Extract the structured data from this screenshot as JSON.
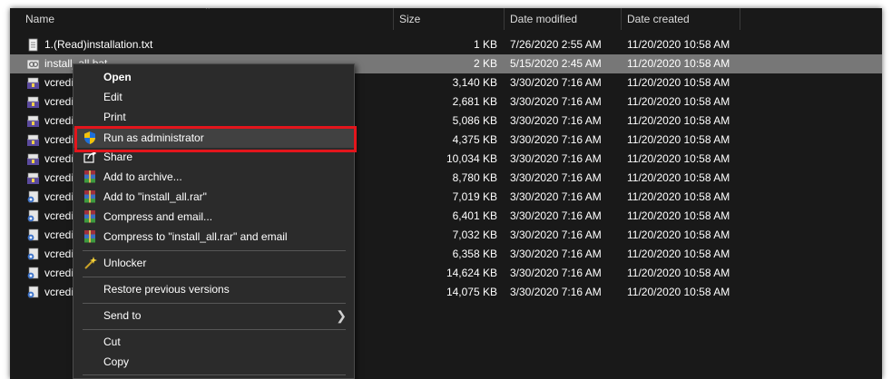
{
  "columns": {
    "name": "Name",
    "size": "Size",
    "modified": "Date modified",
    "created": "Date created"
  },
  "files": [
    {
      "name": "1.(Read)installation.txt",
      "size": "1 KB",
      "modified": "7/26/2020 2:55 AM",
      "created": "11/20/2020 10:58 AM",
      "icon": "text-file-icon",
      "selected": false
    },
    {
      "name": "install_all.bat",
      "size": "2 KB",
      "modified": "5/15/2020 2:45 AM",
      "created": "11/20/2020 10:58 AM",
      "icon": "batch-file-icon",
      "selected": true
    },
    {
      "name": "vcredist",
      "size": "3,140 KB",
      "modified": "3/30/2020 7:16 AM",
      "created": "11/20/2020 10:58 AM",
      "icon": "installer-icon",
      "selected": false
    },
    {
      "name": "vcredist",
      "size": "2,681 KB",
      "modified": "3/30/2020 7:16 AM",
      "created": "11/20/2020 10:58 AM",
      "icon": "installer-icon",
      "selected": false
    },
    {
      "name": "vcredist",
      "size": "5,086 KB",
      "modified": "3/30/2020 7:16 AM",
      "created": "11/20/2020 10:58 AM",
      "icon": "installer-icon",
      "selected": false
    },
    {
      "name": "vcredist",
      "size": "4,375 KB",
      "modified": "3/30/2020 7:16 AM",
      "created": "11/20/2020 10:58 AM",
      "icon": "installer-icon",
      "selected": false
    },
    {
      "name": "vcredist",
      "size": "10,034 KB",
      "modified": "3/30/2020 7:16 AM",
      "created": "11/20/2020 10:58 AM",
      "icon": "installer-icon",
      "selected": false
    },
    {
      "name": "vcredist",
      "size": "8,780 KB",
      "modified": "3/30/2020 7:16 AM",
      "created": "11/20/2020 10:58 AM",
      "icon": "installer-icon",
      "selected": false
    },
    {
      "name": "vcredist",
      "size": "7,019 KB",
      "modified": "3/30/2020 7:16 AM",
      "created": "11/20/2020 10:58 AM",
      "icon": "setup-icon",
      "selected": false
    },
    {
      "name": "vcredist",
      "size": "6,401 KB",
      "modified": "3/30/2020 7:16 AM",
      "created": "11/20/2020 10:58 AM",
      "icon": "setup-icon",
      "selected": false
    },
    {
      "name": "vcredist",
      "size": "7,032 KB",
      "modified": "3/30/2020 7:16 AM",
      "created": "11/20/2020 10:58 AM",
      "icon": "setup-icon",
      "selected": false
    },
    {
      "name": "vcredist",
      "size": "6,358 KB",
      "modified": "3/30/2020 7:16 AM",
      "created": "11/20/2020 10:58 AM",
      "icon": "setup-icon",
      "selected": false
    },
    {
      "name": "vcredist",
      "size": "14,624 KB",
      "modified": "3/30/2020 7:16 AM",
      "created": "11/20/2020 10:58 AM",
      "icon": "setup-icon",
      "selected": false
    },
    {
      "name": "vcredist",
      "size": "14,075 KB",
      "modified": "3/30/2020 7:16 AM",
      "created": "11/20/2020 10:58 AM",
      "icon": "setup-icon",
      "selected": false
    }
  ],
  "context_menu": {
    "items": [
      {
        "label": "Open",
        "bold": true
      },
      {
        "label": "Edit"
      },
      {
        "label": "Print"
      },
      {
        "label": "Run as administrator",
        "icon": "uac-shield-icon",
        "hover": true
      },
      {
        "label": "Share",
        "icon": "share-icon"
      },
      {
        "label": "Add to archive...",
        "icon": "winrar-icon"
      },
      {
        "label": "Add to \"install_all.rar\"",
        "icon": "winrar-icon"
      },
      {
        "label": "Compress and email...",
        "icon": "winrar-icon"
      },
      {
        "label": "Compress to \"install_all.rar\" and email",
        "icon": "winrar-icon"
      },
      {
        "label": "Unlocker",
        "icon": "magic-wand-icon"
      },
      {
        "label": "Restore previous versions"
      },
      {
        "label": "Send to",
        "submenu": true
      },
      {
        "label": "Cut"
      },
      {
        "label": "Copy"
      }
    ]
  },
  "colors": {
    "background": "#191919",
    "selected_row": "#777777",
    "menu_bg": "#2b2b2b",
    "highlight_box": "#e3151c"
  }
}
